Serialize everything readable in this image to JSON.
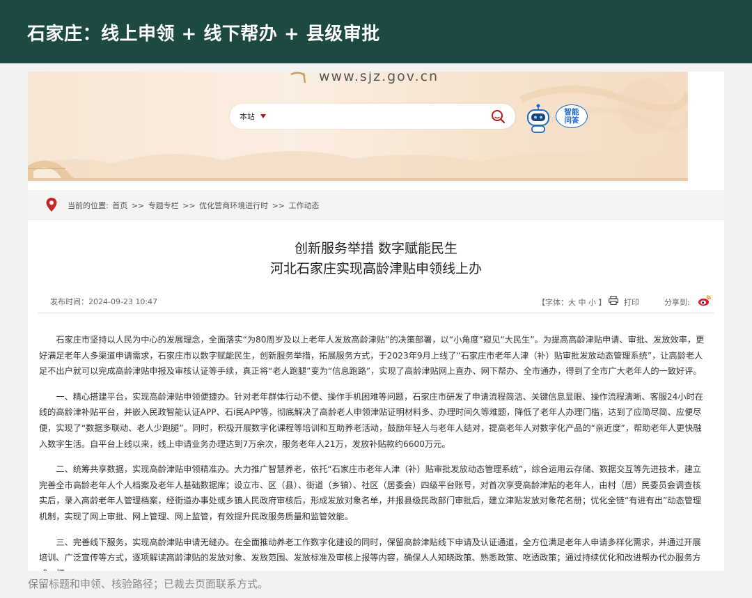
{
  "header": {
    "title": "石家庄：线上申领 + 线下帮办 + 县级审批"
  },
  "site": {
    "url": "www.sjz.gov.cn",
    "search_scope": "本站",
    "ai_assistant_label_line1": "智能",
    "ai_assistant_label_line2": "问答"
  },
  "breadcrumb": {
    "prefix": "当前的位置:",
    "items": [
      "首页",
      "专题专栏",
      "优化营商环境进行时",
      "工作动态"
    ],
    "separator": ">>"
  },
  "article": {
    "title_line1": "创新服务举措 数字赋能民生",
    "title_line2": "河北石家庄实现高龄津贴申领线上办",
    "publish_label": "发布时间：2024-09-23 10:47",
    "font_size_label": "【字体：大 中 小 】",
    "print_label": "打印",
    "share_label": "分享到:",
    "paragraphs": [
      "石家庄市坚持以人民为中心的发展理念，全面落实“为80周岁及以上老年人发放高龄津贴”的决策部署，以“小角度”窥见“大民生”。为提高高龄津贴申请、审批、发放效率，更好满足老年人多渠道申请需求，石家庄市以数字赋能民生，创新服务举措，拓展服务方式，于2023年9月上线了“石家庄市老年人津（补）贴审批发放动态管理系统”，让高龄老人足不出户就可以完成高龄津贴申报及审核认证等手续，真正将“老人跑腿”变为“信息跑路”，实现了高龄津贴网上直办、网下帮办、全市通办，得到了全市广大老年人的一致好评。",
      "一、精心搭建平台，实现高龄津贴申领便捷办。针对老年群体行动不便、操作手机困难等问题，石家庄市研发了申请流程简洁、关键信息显眼、操作流程清晰、客服24小时在线的高龄津补贴平台，并嵌入民政智能认证APP、石i民APP等，彻底解决了高龄老人申领津贴证明材料多、办理时间久等难题，降低了老年人办理门槛，达到了应简尽简、应便尽便，实现了“数据多联动、老人少跑腿”。同时，积极开展数字化课程等培训和互助养老活动，鼓励年轻人与老年人结对，提高老年人对数字化产品的“亲近度”，帮助老年人更快融入数字生活。自平台上线以来，线上申请业务办理达到7万余次，服务老年人21万，发放补贴款约6600万元。",
      "二、统筹共享数据，实现高龄津贴申领精准办。大力推广智慧养老，依托“石家庄市老年人津（补）贴审批发放动态管理系统”，综合运用云存储、数据交互等先进技术，建立完善全市高龄老年人个人档案及老年人基础数据库；设立市、区（县）、街道（乡镇）、社区（居委会）四级平台账号，对首次享受高龄津贴的老年人，由村（居）民委员会调查核实后，录入高龄老年人管理档案，经街道办事处或乡镇人民政府审核后，形成发放对象名单，并报县级民政部门审批后，建立津贴发放对象花名册；优化全链“有进有出”动态管理机制，实现了网上审批、网上管理、网上监管，有效提升民政服务质量和监管效能。",
      "三、完善线下服务，实现高龄津贴申请无缝办。在全面推动养老工作数字化建设的同时，保留高龄津贴线下申请及认证通道，全方位满足老年人申请多样化需求，并通过开展培训、广泛宣传等方式，逐项解读高龄津贴的发放对象、发放范围、发放标准及审核上报等内容，确保人人知晓政策、熟悉政策、吃透政策；通过持续优化和改进帮办代办服务方式，打"
    ]
  },
  "caption": "保留标题和申领、核验路径；已裁去页面联系方式。",
  "colors": {
    "header_bg": "#1c4a42",
    "accent_red": "#b01a1a",
    "ai_blue": "#1a6acb"
  }
}
